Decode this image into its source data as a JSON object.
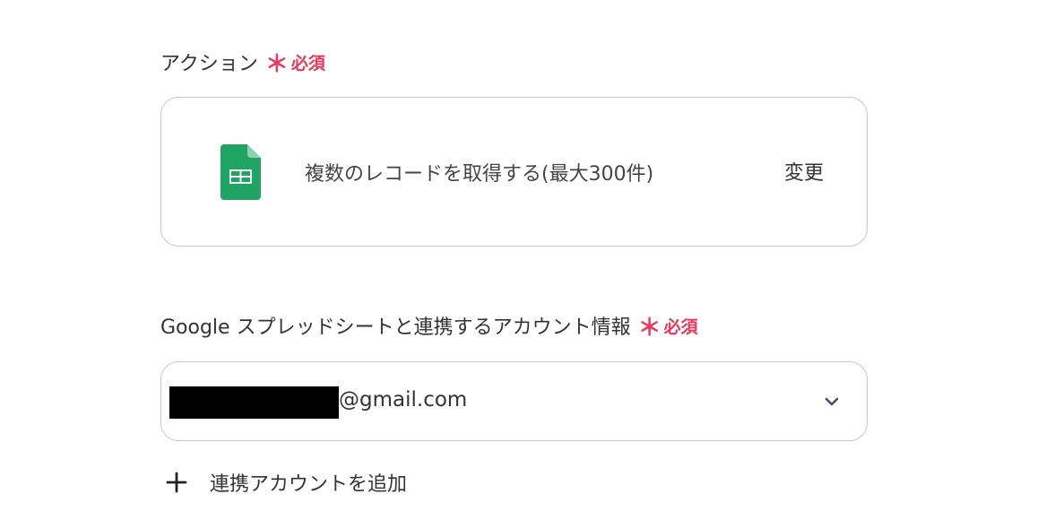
{
  "action_section": {
    "label": "アクション",
    "required_mark": "＊",
    "required_text": "必須",
    "action_label": "複数のレコードを取得する(最大300件)",
    "change_button": "変更",
    "app_icon": "google-sheets-icon"
  },
  "account_section": {
    "label": "Google スプレッドシートと連携するアカウント情報",
    "required_mark": "＊",
    "required_text": "必須",
    "selected_email_suffix": "@gmail.com",
    "dropdown_icon": "chevron-down-icon",
    "add_account_label": "連携アカウントを追加",
    "add_icon": "plus-icon"
  },
  "colors": {
    "required": "#e8385b",
    "sheets_green": "#1fa463",
    "border": "#c6c8d0"
  }
}
